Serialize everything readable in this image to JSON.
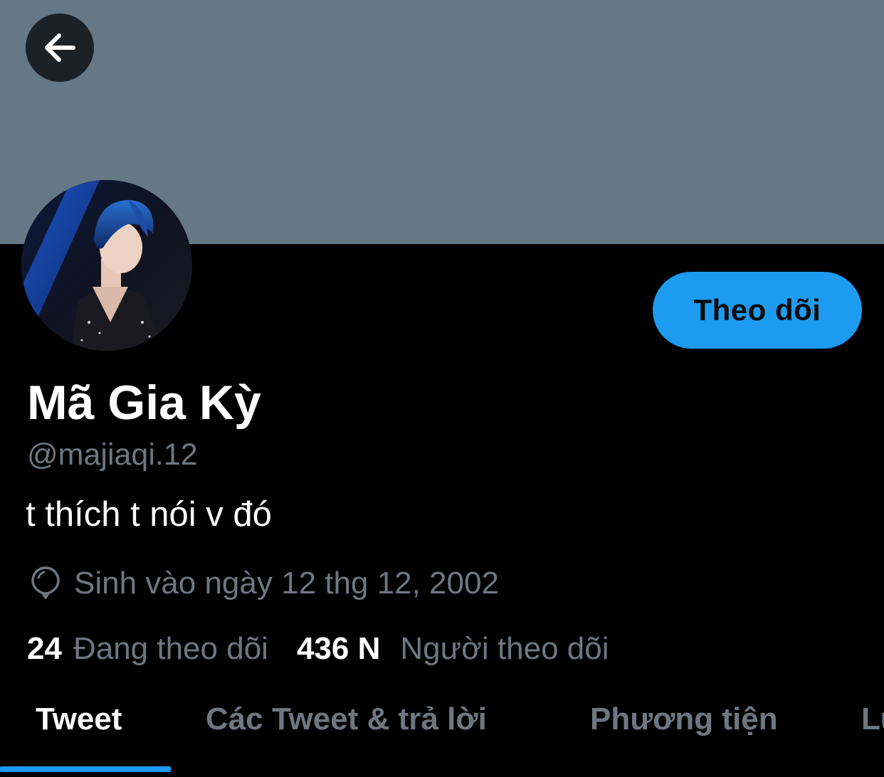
{
  "header": {
    "banner_color": "#667786",
    "back_icon": "arrow-left-icon"
  },
  "profile": {
    "avatar_icon": "profile-photo",
    "follow_label": "Theo dõi",
    "display_name": "Mã Gia Kỳ",
    "handle": "@majiaqi.12",
    "bio": "t thích t nói v đó",
    "birthday_icon": "balloon-icon",
    "birthday_text": "Sinh vào ngày 12 thg 12, 2002"
  },
  "stats": {
    "following_count": "24",
    "following_label": "Đang theo dõi",
    "followers_count": "436 N",
    "followers_label": "Người theo dõi"
  },
  "tabs": [
    {
      "label": "Tweet",
      "active": true
    },
    {
      "label": "Các Tweet & trả lời",
      "active": false
    },
    {
      "label": "Phương tiện",
      "active": false
    },
    {
      "label": "Lư",
      "active": false
    }
  ],
  "colors": {
    "accent": "#1d9bf0",
    "background": "#000000",
    "muted_text": "#6e7781",
    "primary_text": "#ffffff"
  }
}
